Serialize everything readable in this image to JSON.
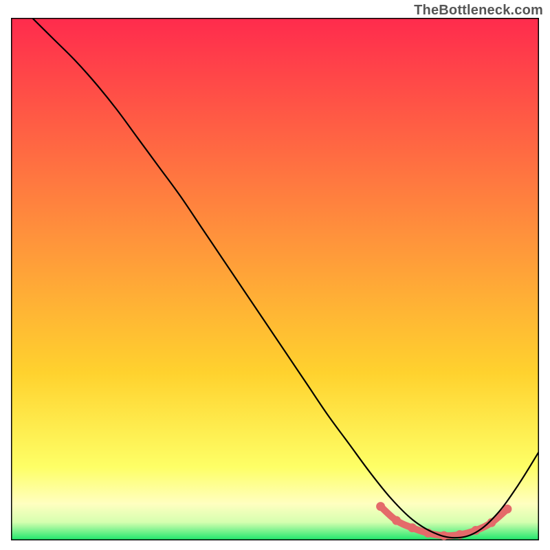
{
  "watermark": "TheBottleneck.com",
  "chart_data": {
    "type": "line",
    "title": "",
    "xlabel": "",
    "ylabel": "",
    "xlim": [
      0,
      100
    ],
    "ylim": [
      0,
      100
    ],
    "grid": false,
    "background_gradient": {
      "top_color": "#ff2b4d",
      "mid_color": "#ffd22e",
      "low_color": "#ffff70",
      "bottom_color": "#19e66a"
    },
    "series": [
      {
        "name": "bottleneck-curve",
        "color": "#000000",
        "x": [
          4,
          8,
          12,
          16,
          20,
          24,
          28,
          32,
          36,
          40,
          44,
          48,
          52,
          56,
          60,
          64,
          68,
          72,
          76,
          80,
          84,
          88,
          92,
          96,
          100
        ],
        "y": [
          100,
          96,
          92,
          87.5,
          82.5,
          77,
          71.5,
          66,
          60,
          54,
          48,
          42,
          36,
          30,
          24,
          18.5,
          13,
          8,
          4,
          1.5,
          0.5,
          1.5,
          5,
          10.5,
          17
        ]
      }
    ],
    "highlight": {
      "name": "bottleneck-valley",
      "color": "#e46a6a",
      "x": [
        70,
        73,
        76,
        79,
        82,
        85,
        88,
        91,
        94
      ],
      "y": [
        6.5,
        3.8,
        2.4,
        1.4,
        0.9,
        1.1,
        1.9,
        3.4,
        6.0
      ]
    }
  }
}
